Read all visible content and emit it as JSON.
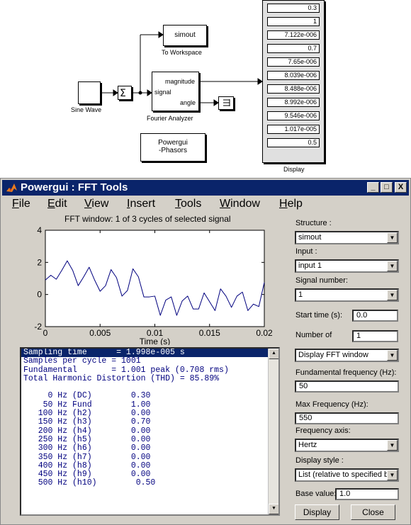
{
  "diagram": {
    "sine_wave_label": "Sine Wave",
    "to_workspace_block": "simout",
    "to_workspace_label": "To Workspace",
    "fourier_port_signal": "signal",
    "fourier_port_magnitude": "magnitude",
    "fourier_port_angle": "angle",
    "fourier_label": "Fourier Analyzer",
    "powergui_line1": "Powergui",
    "powergui_line2": "-Phasors",
    "display_label": "Display",
    "display_values": [
      "0.3",
      "1",
      "7.122e-006",
      "0.7",
      "7.65e-006",
      "8.039e-006",
      "8.488e-006",
      "8.992e-006",
      "9.546e-006",
      "1.017e-005",
      "0.5"
    ]
  },
  "window": {
    "title": "Powergui : FFT Tools",
    "minimize_label": "_",
    "maximize_label": "□",
    "close_label": "X",
    "menu": [
      {
        "key": "F",
        "rest": "ile"
      },
      {
        "key": "E",
        "rest": "dit"
      },
      {
        "key": "V",
        "rest": "iew"
      },
      {
        "key": "I",
        "rest": "nsert"
      },
      {
        "key": "T",
        "rest": "ools"
      },
      {
        "key": "W",
        "rest": "indow"
      },
      {
        "key": "H",
        "rest": "elp"
      }
    ]
  },
  "plot": {
    "title": "FFT window: 1 of 3 cycles of selected signal",
    "xlabel": "Time (s)"
  },
  "chart_data": {
    "type": "line",
    "title": "FFT window: 1 of 3 cycles of selected signal",
    "xlabel": "Time (s)",
    "ylabel": "",
    "xlim": [
      0,
      0.02
    ],
    "ylim": [
      -2,
      4
    ],
    "xticks": [
      "0",
      "0.005",
      "0.01",
      "0.015",
      "0.02"
    ],
    "yticks": [
      "4",
      "2",
      "0",
      "-2"
    ],
    "line_color": "#00007f",
    "series": [
      {
        "x": [
          0,
          0.0005,
          0.001,
          0.0015,
          0.002,
          0.0025,
          0.003,
          0.0035,
          0.004,
          0.0045,
          0.005,
          0.0055,
          0.006,
          0.0065,
          0.007,
          0.0075,
          0.008,
          0.0085,
          0.009,
          0.0095,
          0.01,
          0.0105,
          0.011,
          0.0115,
          0.012,
          0.0125,
          0.013,
          0.0135,
          0.014,
          0.0145,
          0.015,
          0.0155,
          0.016,
          0.0165,
          0.017,
          0.0175,
          0.018,
          0.0185,
          0.019,
          0.0195,
          0.02
        ],
        "values": [
          0.9,
          1.2,
          0.95,
          1.5,
          2.1,
          1.5,
          0.55,
          1.1,
          1.7,
          0.9,
          0.2,
          0.55,
          1.55,
          1.05,
          -0.1,
          0.25,
          1.6,
          1.1,
          -0.15,
          -0.15,
          -0.1,
          -1.3,
          -0.35,
          -0.15,
          -1.3,
          -0.4,
          -0.1,
          -0.9,
          -0.9,
          0.1,
          -0.45,
          -1.0,
          0.35,
          -0.1,
          -0.8,
          -0.1,
          0.15,
          -1.0,
          -0.6,
          -0.75,
          0.75
        ]
      }
    ]
  },
  "listing": {
    "lines": [
      "Sampling time      = 1.998e-005 s",
      "Samples per cycle = 1001",
      "Fundamental       = 1.001 peak (0.708 rms)",
      "Total Harmonic Distortion (THD) = 85.89%",
      "",
      "     0 Hz (DC)        0.30",
      "    50 Hz Fund        1.00",
      "   100 Hz (h2)        0.00",
      "   150 Hz (h3)        0.70",
      "   200 Hz (h4)        0.00",
      "   250 Hz (h5)        0.00",
      "   300 Hz (h6)        0.00",
      "   350 Hz (h7)        0.00",
      "   400 Hz (h8)        0.00",
      "   450 Hz (h9)        0.00",
      "   500 Hz (h10)        0.50"
    ]
  },
  "panel": {
    "structure_label": "Structure :",
    "structure_value": "simout",
    "input_label": "Input :",
    "input_value": "input 1",
    "signal_number_label": "Signal number:",
    "signal_number_value": "1",
    "start_time_label": "Start time (s):",
    "start_time_value": "0.0",
    "number_of_label": "Number of",
    "number_of_value": "1",
    "display_mode_value": "Display FFT window",
    "fundamental_label": "Fundamental frequency (Hz):",
    "fundamental_value": "50",
    "max_freq_label": "Max Frequency (Hz):",
    "max_freq_value": "550",
    "freq_axis_label": "Frequency axis:",
    "freq_axis_value": "Hertz",
    "display_style_label": "Display style :",
    "display_style_value": "List (relative to specified ba",
    "base_value_label": "Base value:",
    "base_value_value": "1.0",
    "display_button": "Display",
    "close_button": "Close"
  }
}
